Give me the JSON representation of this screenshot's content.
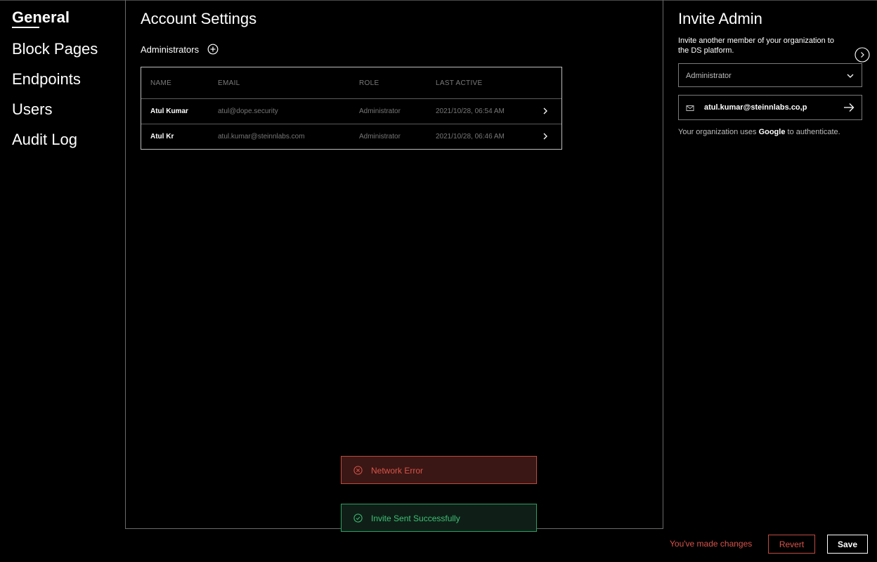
{
  "sidebar": {
    "items": [
      {
        "label": "General",
        "active": true
      },
      {
        "label": "Block Pages"
      },
      {
        "label": "Endpoints"
      },
      {
        "label": "Users"
      },
      {
        "label": "Audit Log"
      }
    ]
  },
  "main": {
    "title": "Account Settings",
    "section_label": "Administrators",
    "table": {
      "headers": [
        "NAME",
        "EMAIL",
        "ROLE",
        "LAST ACTIVE"
      ],
      "rows": [
        {
          "name": "Atul Kumar",
          "email": "atul@dope.security",
          "role": "Administrator",
          "last_active": "2021/10/28, 06:54 AM"
        },
        {
          "name": "Atul Kr",
          "email": "atul.kumar@steinnlabs.com",
          "role": "Administrator",
          "last_active": "2021/10/28, 06:46 AM"
        }
      ]
    }
  },
  "toasts": {
    "error": "Network Error",
    "success": "Invite Sent Successfully"
  },
  "invite_panel": {
    "title": "Invite Admin",
    "description": "Invite another member of your organization to the DS platform.",
    "role_select": {
      "value": "Administrator"
    },
    "email_input": {
      "value": "atul.kumar@steinnlabs.co,p"
    },
    "auth_prefix": "Your organization uses ",
    "auth_provider": "Google",
    "auth_suffix": " to authenticate."
  },
  "footer": {
    "changes_text": "You've made changes",
    "revert_label": "Revert",
    "save_label": "Save"
  },
  "colors": {
    "background": "#000000",
    "error": "#d9534a",
    "success": "#3fbf76"
  }
}
